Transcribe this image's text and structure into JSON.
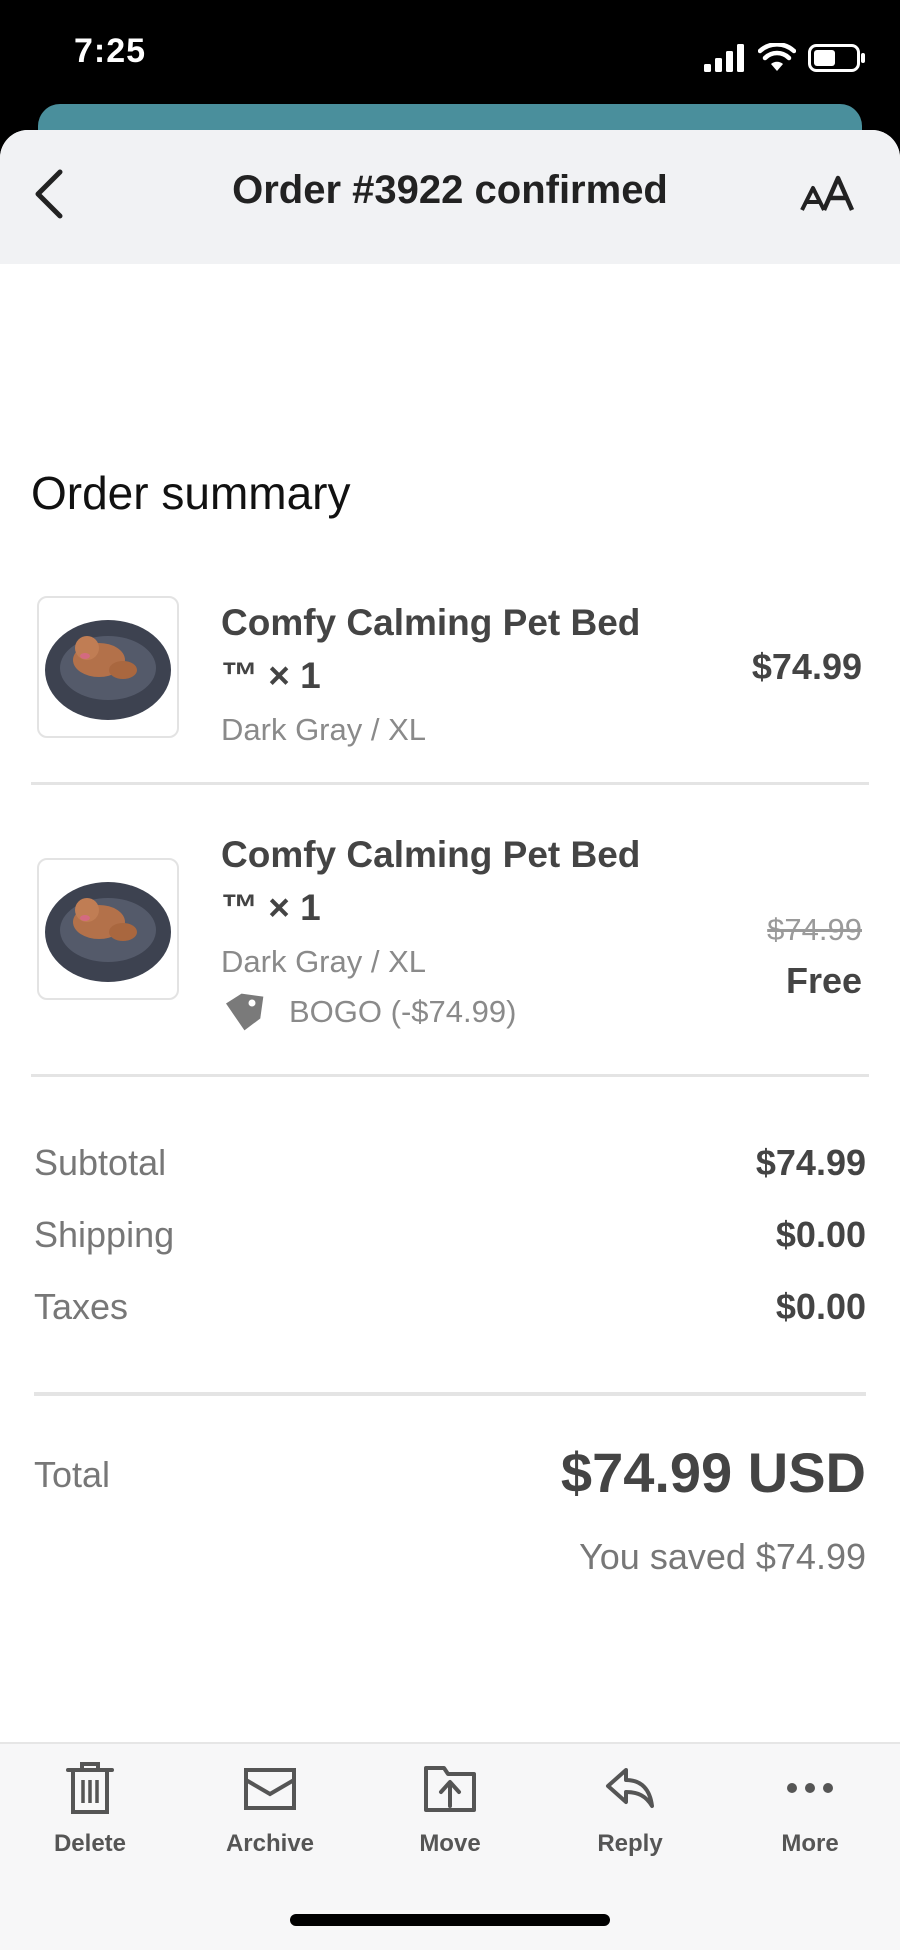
{
  "status_bar": {
    "time": "7:25",
    "icons": [
      "signal-icon",
      "wifi-icon",
      "battery-icon"
    ]
  },
  "header": {
    "back_icon": "chevron-left-icon",
    "title": "Order #3922 confirmed",
    "text_size_icon": "text-size-icon"
  },
  "order_summary": {
    "title": "Order summary",
    "items": [
      {
        "name_line1": "Comfy Calming Pet Bed",
        "name_line2": "™ × 1",
        "variant": "Dark Gray / XL",
        "price": "$74.99"
      },
      {
        "name_line1": "Comfy Calming Pet Bed",
        "name_line2": "™ × 1",
        "variant": "Dark Gray / XL",
        "original_price": "$74.99",
        "price": "Free",
        "discount": "BOGO (-$74.99)"
      }
    ],
    "subtotal_label": "Subtotal",
    "subtotal_value": "$74.99",
    "shipping_label": "Shipping",
    "shipping_value": "$0.00",
    "taxes_label": "Taxes",
    "taxes_value": "$0.00",
    "total_label": "Total",
    "total_value": "$74.99 USD",
    "saved_text": "You saved $74.99"
  },
  "toolbar": {
    "delete": "Delete",
    "archive": "Archive",
    "move": "Move",
    "reply": "Reply",
    "more": "More"
  },
  "colors": {
    "header_bg": "#f1f2f4",
    "behind_sheet": "#4a8f9c",
    "text_dark": "#444444",
    "text_muted": "#8a8a8a"
  }
}
